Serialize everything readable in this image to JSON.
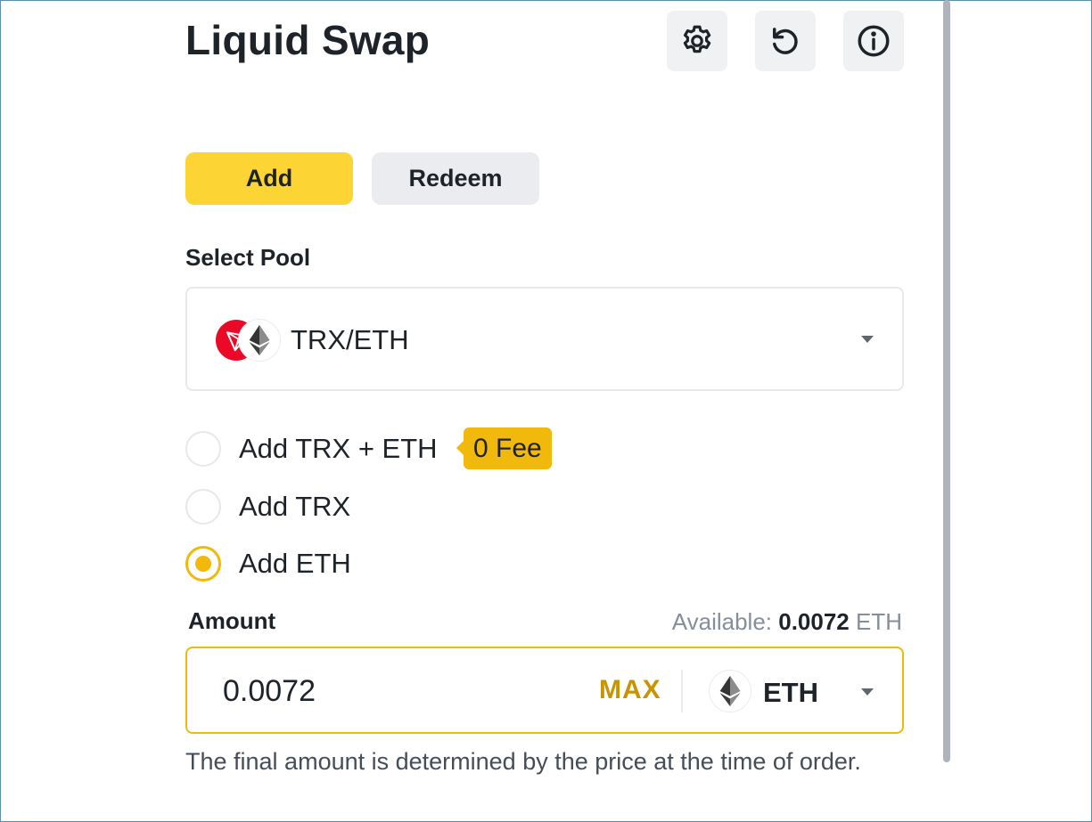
{
  "header": {
    "title": "Liquid Swap",
    "icons": [
      "gear-icon",
      "history-icon",
      "info-icon"
    ]
  },
  "tabs": [
    {
      "label": "Add",
      "active": true
    },
    {
      "label": "Redeem",
      "active": false
    }
  ],
  "pool": {
    "label": "Select Pool",
    "selected": "TRX/ETH",
    "icons": [
      "trx-coin-icon",
      "eth-coin-icon"
    ]
  },
  "options": [
    {
      "label": "Add TRX + ETH",
      "checked": false,
      "badge": "0 Fee"
    },
    {
      "label": "Add TRX",
      "checked": false
    },
    {
      "label": "Add ETH",
      "checked": true
    }
  ],
  "amount": {
    "label": "Amount",
    "available_prefix": "Available: ",
    "available_value": "0.0072",
    "available_unit": " ETH",
    "value": "0.0072",
    "max_label": "MAX",
    "asset": "ETH"
  },
  "note": "The final amount is determined by the price at the time of order.",
  "colors": {
    "accent": "#fcd535",
    "accent_dark": "#f0b90b",
    "max_text": "#c99400",
    "trx_red": "#ea0a27",
    "text_primary": "#1e2329",
    "text_secondary": "#848e9c"
  }
}
